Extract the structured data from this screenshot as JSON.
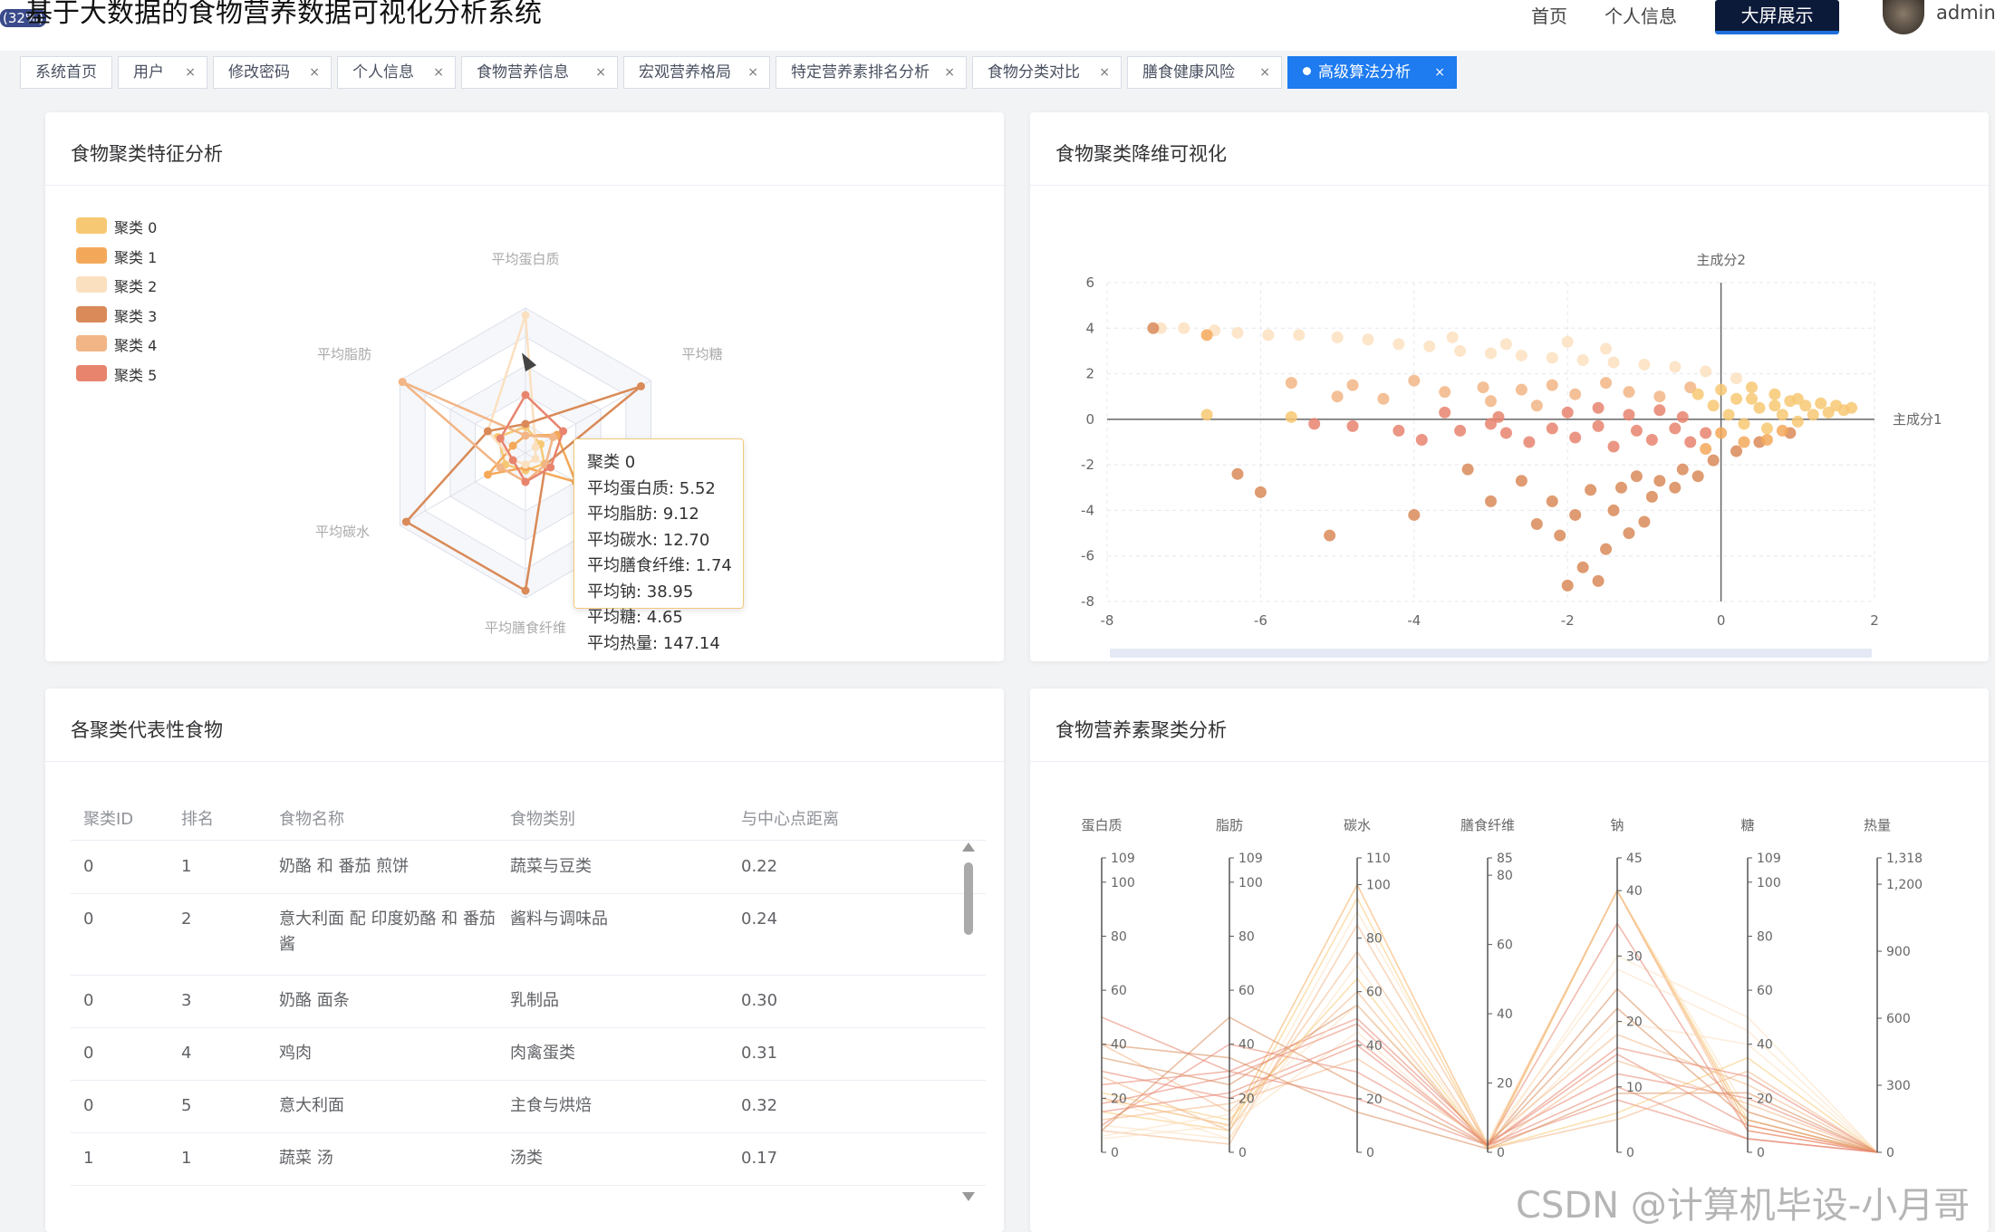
{
  "app": {
    "badge": "(32%)",
    "title": "基于大数据的食物营养数据可视化分析系统",
    "nav": {
      "home": "首页",
      "profile": "个人信息",
      "bigscreen": "大屏展示",
      "user": "admin"
    }
  },
  "tabs": [
    {
      "label": "系统首页",
      "closable": false
    },
    {
      "label": "用户",
      "closable": true
    },
    {
      "label": "修改密码",
      "closable": true
    },
    {
      "label": "个人信息",
      "closable": true
    },
    {
      "label": "食物营养信息",
      "closable": true
    },
    {
      "label": "宏观营养格局",
      "closable": true
    },
    {
      "label": "特定营养素排名分析",
      "closable": true
    },
    {
      "label": "食物分类对比",
      "closable": true
    },
    {
      "label": "膳食健康风险",
      "closable": true
    },
    {
      "label": "高级算法分析",
      "closable": true,
      "active": true
    }
  ],
  "close_glyph": "×",
  "panels": {
    "radar_title": "食物聚类特征分析",
    "scatter_title": "食物聚类降维可视化",
    "table_title": "各聚类代表性食物",
    "parallel_title": "食物营养素聚类分析"
  },
  "tooltip": {
    "title": "聚类 0",
    "lines": [
      "平均蛋白质: 5.52",
      "平均脂肪: 9.12",
      "平均碳水: 12.70",
      "平均膳食纤维: 1.74",
      "平均钠: 38.95",
      "平均糖: 4.65",
      "平均热量: 147.14"
    ]
  },
  "table": {
    "headers": [
      "聚类ID",
      "排名",
      "食物名称",
      "食物类别",
      "与中心点距离"
    ],
    "rows": [
      {
        "cluster": "0",
        "rank": "1",
        "name": "奶酪 和 番茄 煎饼",
        "category": "蔬菜与豆类",
        "dist": "0.22"
      },
      {
        "cluster": "0",
        "rank": "2",
        "name": "意大利面 配 印度奶酪 和 番茄 酱",
        "category": "酱料与调味品",
        "dist": "0.24"
      },
      {
        "cluster": "0",
        "rank": "3",
        "name": "奶酪 面条",
        "category": "乳制品",
        "dist": "0.30"
      },
      {
        "cluster": "0",
        "rank": "4",
        "name": "鸡肉",
        "category": "肉禽蛋类",
        "dist": "0.31"
      },
      {
        "cluster": "0",
        "rank": "5",
        "name": "意大利面",
        "category": "主食与烘焙",
        "dist": "0.32"
      },
      {
        "cluster": "1",
        "rank": "1",
        "name": "蔬菜 汤",
        "category": "汤类",
        "dist": "0.17"
      }
    ]
  },
  "watermark": "CSDN @计算机毕设-小月哥",
  "chart_data": [
    {
      "type": "radar",
      "legend": [
        "聚类 0",
        "聚类 1",
        "聚类 2",
        "聚类 3",
        "聚类 4",
        "聚类 5"
      ],
      "colors": [
        "#f7c873",
        "#f4a95a",
        "#fbe0c0",
        "#d98a58",
        "#f2b585",
        "#e8846e"
      ],
      "indicators": [
        "平均蛋白质",
        "平均糖",
        "平均钠",
        "平均膳食纤维",
        "平均碳水",
        "平均脂肪"
      ],
      "series": [
        {
          "name": "聚类 0",
          "values": [
            0.18,
            0.12,
            0.15,
            0.12,
            0.16,
            0.22
          ]
        },
        {
          "name": "聚类 1",
          "values": [
            0.12,
            0.25,
            0.4,
            0.1,
            0.3,
            0.1
          ]
        },
        {
          "name": "聚类 2",
          "values": [
            0.95,
            0.08,
            0.08,
            0.08,
            0.1,
            0.3
          ]
        },
        {
          "name": "聚类 3",
          "values": [
            0.2,
            0.92,
            0.16,
            0.95,
            0.95,
            0.3
          ]
        },
        {
          "name": "聚类 4",
          "values": [
            0.12,
            0.22,
            0.16,
            0.2,
            0.2,
            0.98
          ]
        },
        {
          "name": "聚类 5",
          "values": [
            0.4,
            0.3,
            0.2,
            0.2,
            0.1,
            0.2
          ]
        }
      ]
    },
    {
      "type": "scatter",
      "xlabel": "主成分1",
      "ylabel": "主成分2",
      "xlim": [
        -8,
        2
      ],
      "ylim": [
        -8,
        6
      ],
      "xticks": [
        "-8",
        "-6",
        "-4",
        "-2",
        "0",
        "2"
      ],
      "yticks": [
        "6",
        "4",
        "2",
        "0",
        "-2",
        "-4",
        "-6",
        "-8"
      ],
      "colors": [
        "#f7c873",
        "#f4a95a",
        "#fbe0c0",
        "#d98a58",
        "#f2b585",
        "#e8846e"
      ],
      "points": [
        [
          -7.3,
          4.0,
          2
        ],
        [
          -7.0,
          4.0,
          2
        ],
        [
          -6.6,
          3.9,
          2
        ],
        [
          -6.3,
          3.8,
          2
        ],
        [
          -5.9,
          3.7,
          2
        ],
        [
          -5.5,
          3.7,
          2
        ],
        [
          -5.0,
          3.6,
          2
        ],
        [
          -4.6,
          3.5,
          2
        ],
        [
          -4.2,
          3.3,
          2
        ],
        [
          -3.8,
          3.2,
          2
        ],
        [
          -3.4,
          3.0,
          2
        ],
        [
          -3.0,
          2.9,
          2
        ],
        [
          -2.6,
          2.8,
          2
        ],
        [
          -2.2,
          2.7,
          2
        ],
        [
          -1.8,
          2.6,
          2
        ],
        [
          -1.4,
          2.5,
          2
        ],
        [
          -1.0,
          2.4,
          2
        ],
        [
          -0.6,
          2.3,
          2
        ],
        [
          -0.2,
          2.1,
          2
        ],
        [
          0.2,
          1.8,
          2
        ],
        [
          -2.0,
          3.4,
          2
        ],
        [
          -1.5,
          3.1,
          2
        ],
        [
          -3.5,
          3.6,
          2
        ],
        [
          -2.8,
          3.3,
          2
        ],
        [
          -7.4,
          4.0,
          3
        ],
        [
          -6.7,
          3.7,
          1
        ],
        [
          -5.6,
          1.6,
          4
        ],
        [
          -4.8,
          1.5,
          4
        ],
        [
          -4.0,
          1.7,
          4
        ],
        [
          -3.6,
          1.2,
          4
        ],
        [
          -3.1,
          1.4,
          4
        ],
        [
          -2.6,
          1.3,
          4
        ],
        [
          -2.2,
          1.5,
          4
        ],
        [
          -1.9,
          1.1,
          4
        ],
        [
          -1.5,
          1.6,
          4
        ],
        [
          -1.2,
          1.2,
          4
        ],
        [
          -0.8,
          1.0,
          4
        ],
        [
          -0.4,
          1.4,
          4
        ],
        [
          -3.0,
          0.8,
          4
        ],
        [
          -2.4,
          0.6,
          4
        ],
        [
          -4.4,
          0.9,
          4
        ],
        [
          -5.0,
          1.0,
          4
        ],
        [
          -6.7,
          0.2,
          0
        ],
        [
          -5.6,
          0.1,
          0
        ],
        [
          -5.3,
          -0.2,
          5
        ],
        [
          -4.8,
          -0.3,
          5
        ],
        [
          -4.2,
          -0.5,
          5
        ],
        [
          -3.9,
          -0.9,
          5
        ],
        [
          -3.4,
          -0.5,
          5
        ],
        [
          -3.0,
          -0.2,
          5
        ],
        [
          -2.8,
          -0.6,
          5
        ],
        [
          -2.5,
          -1.0,
          5
        ],
        [
          -2.2,
          -0.4,
          5
        ],
        [
          -1.9,
          -0.8,
          5
        ],
        [
          -1.6,
          -0.3,
          5
        ],
        [
          -1.4,
          -1.2,
          5
        ],
        [
          -1.1,
          -0.5,
          5
        ],
        [
          -0.9,
          -0.9,
          5
        ],
        [
          -0.6,
          -0.4,
          5
        ],
        [
          -0.4,
          -1.0,
          5
        ],
        [
          -0.2,
          -0.6,
          5
        ],
        [
          -2.0,
          0.3,
          5
        ],
        [
          -1.6,
          0.5,
          5
        ],
        [
          -1.2,
          0.2,
          5
        ],
        [
          -0.8,
          0.4,
          5
        ],
        [
          -0.5,
          0.1,
          5
        ],
        [
          -2.9,
          0.1,
          5
        ],
        [
          -3.6,
          0.3,
          5
        ],
        [
          -6.3,
          -2.4,
          3
        ],
        [
          -6.0,
          -3.2,
          3
        ],
        [
          -5.1,
          -5.1,
          3
        ],
        [
          -4.0,
          -4.2,
          3
        ],
        [
          -3.3,
          -2.2,
          3
        ],
        [
          -3.0,
          -3.6,
          3
        ],
        [
          -2.6,
          -2.7,
          3
        ],
        [
          -2.4,
          -4.6,
          3
        ],
        [
          -2.2,
          -3.6,
          3
        ],
        [
          -2.1,
          -5.1,
          3
        ],
        [
          -2.0,
          -7.3,
          3
        ],
        [
          -1.9,
          -4.2,
          3
        ],
        [
          -1.8,
          -6.5,
          3
        ],
        [
          -1.7,
          -3.1,
          3
        ],
        [
          -1.5,
          -5.7,
          3
        ],
        [
          -1.4,
          -4.0,
          3
        ],
        [
          -1.3,
          -3.0,
          3
        ],
        [
          -1.2,
          -5.0,
          3
        ],
        [
          -1.1,
          -2.5,
          3
        ],
        [
          -1.0,
          -4.5,
          3
        ],
        [
          -0.9,
          -3.4,
          3
        ],
        [
          -0.8,
          -2.7,
          3
        ],
        [
          -0.6,
          -3.0,
          3
        ],
        [
          -0.5,
          -2.2,
          3
        ],
        [
          -0.3,
          -2.5,
          3
        ],
        [
          -0.1,
          -1.8,
          3
        ],
        [
          0.2,
          -1.4,
          3
        ],
        [
          0.5,
          -1.0,
          3
        ],
        [
          0.9,
          -0.6,
          3
        ],
        [
          -1.6,
          -7.1,
          3
        ],
        [
          -0.3,
          1.1,
          0
        ],
        [
          -0.1,
          0.6,
          0
        ],
        [
          0.0,
          1.3,
          0
        ],
        [
          0.1,
          0.2,
          0
        ],
        [
          0.2,
          0.9,
          0
        ],
        [
          0.3,
          -0.2,
          0
        ],
        [
          0.4,
          1.4,
          0
        ],
        [
          0.5,
          0.5,
          0
        ],
        [
          0.6,
          -0.4,
          0
        ],
        [
          0.7,
          1.1,
          0
        ],
        [
          0.8,
          0.2,
          0
        ],
        [
          0.9,
          0.8,
          0
        ],
        [
          1.0,
          -0.1,
          0
        ],
        [
          1.1,
          0.6,
          0
        ],
        [
          1.2,
          0.2,
          0
        ],
        [
          1.3,
          0.7,
          0
        ],
        [
          1.4,
          0.3,
          0
        ],
        [
          1.5,
          0.6,
          0
        ],
        [
          1.6,
          0.4,
          0
        ],
        [
          1.7,
          0.5,
          0
        ],
        [
          0.0,
          -0.6,
          1
        ],
        [
          0.3,
          -1.0,
          1
        ],
        [
          0.6,
          -0.9,
          1
        ],
        [
          -0.2,
          -1.3,
          1
        ],
        [
          0.8,
          -0.5,
          1
        ],
        [
          1.0,
          0.9,
          0
        ],
        [
          0.4,
          0.9,
          0
        ],
        [
          0.7,
          0.6,
          0
        ]
      ]
    },
    {
      "type": "parallel",
      "axes": [
        {
          "name": "蛋白质",
          "max": 109,
          "ticks": [
            "109",
            "100",
            "80",
            "60",
            "40",
            "20",
            "0"
          ],
          "values": [
            109,
            100,
            80,
            60,
            40,
            20,
            0
          ]
        },
        {
          "name": "脂肪",
          "max": 109,
          "ticks": [
            "109",
            "100",
            "80",
            "60",
            "40",
            "20",
            "0"
          ],
          "values": [
            109,
            100,
            80,
            60,
            40,
            20,
            0
          ]
        },
        {
          "name": "碳水",
          "max": 110,
          "ticks": [
            "110",
            "100",
            "80",
            "60",
            "40",
            "20",
            "0"
          ],
          "values": [
            110,
            100,
            80,
            60,
            40,
            20,
            0
          ]
        },
        {
          "name": "膳食纤维",
          "max": 85,
          "ticks": [
            "85",
            "80",
            "60",
            "40",
            "20",
            "0"
          ],
          "values": [
            85,
            80,
            60,
            40,
            20,
            0
          ]
        },
        {
          "name": "钠",
          "max": 45,
          "ticks": [
            "45",
            "40",
            "30",
            "20",
            "10",
            "0"
          ],
          "values": [
            45,
            40,
            30,
            20,
            10,
            0
          ]
        },
        {
          "name": "糖",
          "max": 109,
          "ticks": [
            "109",
            "100",
            "80",
            "60",
            "40",
            "20",
            "0"
          ],
          "values": [
            109,
            100,
            80,
            60,
            40,
            20,
            0
          ]
        },
        {
          "name": "热量",
          "max": 1318,
          "ticks": [
            "1,318",
            "1,200",
            "900",
            "600",
            "300",
            "0"
          ],
          "values": [
            1318,
            1200,
            900,
            600,
            300,
            0
          ]
        }
      ],
      "colors": [
        "#f7c873",
        "#f4a95a",
        "#fbe0c0",
        "#d98a58",
        "#f2b585",
        "#e8846e"
      ],
      "lines": [
        [
          20,
          10,
          100,
          2,
          40,
          10,
          0,
          1
        ],
        [
          15,
          8,
          95,
          1,
          40,
          12,
          0,
          0
        ],
        [
          10,
          5,
          90,
          3,
          40,
          15,
          0,
          2
        ],
        [
          8,
          3,
          85,
          2,
          40,
          8,
          0,
          4
        ],
        [
          30,
          20,
          40,
          2,
          8,
          5,
          0,
          5
        ],
        [
          25,
          30,
          50,
          3,
          12,
          20,
          0,
          5
        ],
        [
          40,
          15,
          60,
          1,
          5,
          30,
          0,
          4
        ],
        [
          10,
          40,
          30,
          2,
          15,
          10,
          0,
          5
        ],
        [
          5,
          10,
          45,
          1,
          20,
          40,
          0,
          2
        ],
        [
          35,
          25,
          55,
          2,
          25,
          15,
          0,
          3
        ],
        [
          20,
          5,
          70,
          1,
          30,
          50,
          0,
          2
        ],
        [
          12,
          18,
          35,
          3,
          18,
          25,
          0,
          4
        ],
        [
          50,
          30,
          20,
          2,
          10,
          5,
          0,
          5
        ],
        [
          22,
          12,
          65,
          1,
          6,
          35,
          0,
          0
        ],
        [
          8,
          50,
          25,
          2,
          22,
          12,
          0,
          3
        ],
        [
          28,
          8,
          75,
          1,
          14,
          18,
          0,
          4
        ],
        [
          15,
          22,
          42,
          2,
          35,
          8,
          0,
          5
        ],
        [
          40,
          35,
          15,
          1,
          9,
          22,
          0,
          3
        ],
        [
          6,
          14,
          55,
          3,
          28,
          45,
          0,
          2
        ],
        [
          18,
          28,
          48,
          2,
          16,
          28,
          0,
          5
        ]
      ]
    }
  ]
}
